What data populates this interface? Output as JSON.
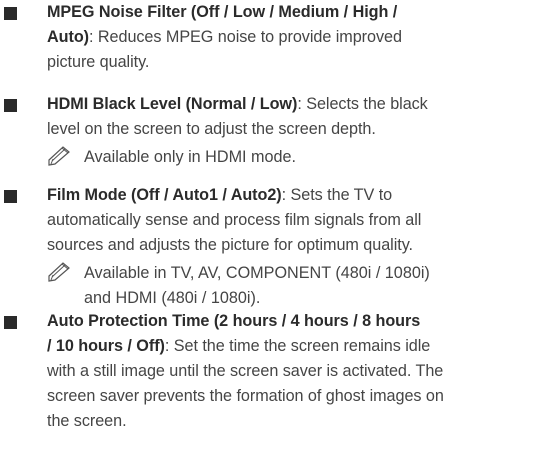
{
  "icons": {
    "bullet": "square-bullet-icon",
    "note": "note-pencil-icon"
  },
  "items": [
    {
      "title_line1": "MPEG Noise Filter (Off / Low / Medium / High /",
      "title_line2": "Auto)",
      "desc_line1": ": Reduces MPEG noise to provide improved",
      "desc_line2": "picture quality."
    },
    {
      "title": "HDMI Black Level (Normal / Low)",
      "desc_line1": ": Selects the black",
      "desc_line2": "level on the screen to adjust the screen depth.",
      "note": "Available only in HDMI mode."
    },
    {
      "title": "Film Mode (Off / Auto1 / Auto2)",
      "desc_line1": ": Sets the TV to",
      "desc_line2": "automatically sense and process film signals from all",
      "desc_line3": "sources and adjusts the picture for optimum quality.",
      "note_line1": "Available in TV, AV, COMPONENT (480i / 1080i)",
      "note_line2": "and HDMI (480i / 1080i)."
    },
    {
      "title_line1": "Auto Protection Time (2 hours / 4 hours / 8 hours",
      "title_line2": "/ 10 hours / Off)",
      "desc_line1": ": Set the time the screen remains idle",
      "desc_line2": "with a still image until the screen saver is activated. The",
      "desc_line3": "screen saver prevents the formation of ghost images on",
      "desc_line4": "the screen."
    }
  ]
}
